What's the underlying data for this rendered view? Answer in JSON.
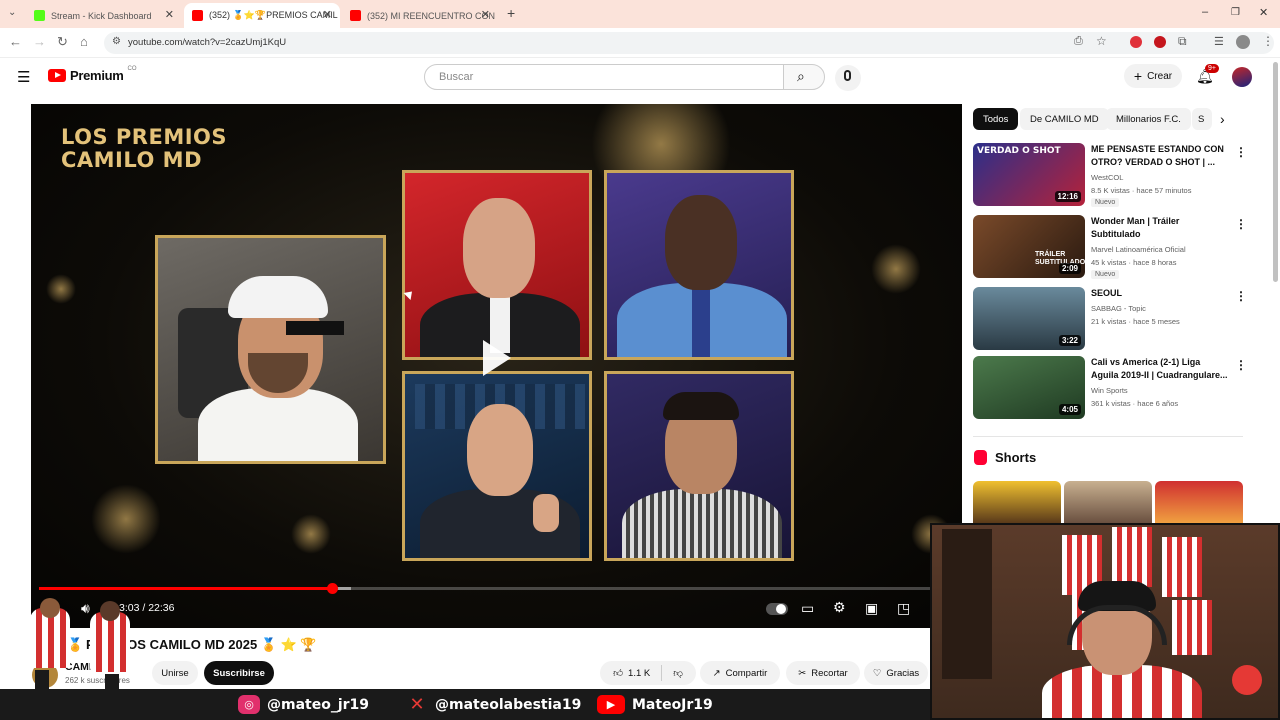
{
  "browser": {
    "tabs": [
      {
        "title": "Stream - Kick Dashboard",
        "favicon_color": "#53fc18",
        "active": false
      },
      {
        "title": "(352) 🏅⭐🏆PREMIOS CAMIL",
        "favicon_color": "#ff0000",
        "active": true
      },
      {
        "title": "(352) MI REENCUENTRO CON",
        "favicon_color": "#ff0000",
        "active": false
      }
    ],
    "new_tab": "+",
    "url": "youtube.com/watch?v=2cazUmj1KqU",
    "window_controls": [
      "–",
      "❐",
      "✕"
    ]
  },
  "youtube": {
    "logo_text": "Premium",
    "logo_region": "CO",
    "search_placeholder": "Buscar",
    "create_label": "Crear",
    "notif_count": "9+"
  },
  "video": {
    "overlay_title_line1": "LOS PREMIOS",
    "overlay_title_line2": "CAMILO MD",
    "time_current": "3:03",
    "time_total": "22:36",
    "time_display": "3:03 / 22:36",
    "progress_fraction": 0.328,
    "buffered_fraction": 0.35
  },
  "info": {
    "title": "PREMIOS CAMILO MD 2025 🏅 ⭐ 🏆",
    "title_prefix": "🏅",
    "channel": "CAMILO MD",
    "subscribers": "262 k suscriptores",
    "join_label": "Unirse",
    "subscribe_label": "Suscribirse",
    "likes": "1.1 K",
    "share_label": "Compartir",
    "clip_label": "Recortar",
    "thanks_label": "Gracias"
  },
  "sidebar": {
    "chips": [
      "Todos",
      "De CAMILO MD",
      "Millonarios F.C.",
      "S"
    ],
    "recommendations": [
      {
        "title": "ME PENSASTE ESTANDO CON OTRO? VERDAD O SHOT | ...",
        "channel": "WestCOL",
        "meta": "8.5 K vistas · hace 57 minutos",
        "badge": "Nuevo",
        "duration": "12:16",
        "thumb_text": "VERDAD O SHOT",
        "color": "#9c1e2a"
      },
      {
        "title": "Wonder Man | Tráiler Subtitulado",
        "channel": "Marvel Latinoamérica Oficial",
        "meta": "45 k vistas · hace 8 horas",
        "badge": "Nuevo",
        "duration": "2:09",
        "thumb_text": "TRÁILER SUBTITULADO",
        "color": "#6a3b22"
      },
      {
        "title": "SEOUL",
        "channel": "SABBAG - Topic",
        "meta": "21 k vistas · hace 5 meses",
        "badge": "",
        "duration": "3:22",
        "thumb_text": "",
        "color": "#3a4f5d"
      },
      {
        "title": "Cali vs America (2-1) Liga Aguila 2019-II | Cuadrangulare...",
        "channel": "Win Sports",
        "meta": "361 k vistas · hace 6 años",
        "badge": "",
        "duration": "4:05",
        "thumb_text": "",
        "color": "#2f5f3a"
      }
    ],
    "shorts_label": "Shorts"
  },
  "stream": {
    "socials": [
      {
        "platform": "instagram",
        "handle": "@mateo_jr19",
        "color": "#e1306c"
      },
      {
        "platform": "x",
        "handle": "@mateolabestia19",
        "color": "#e53935"
      },
      {
        "platform": "youtube",
        "handle": "MateoJr19",
        "color": "#ff0000"
      }
    ]
  }
}
